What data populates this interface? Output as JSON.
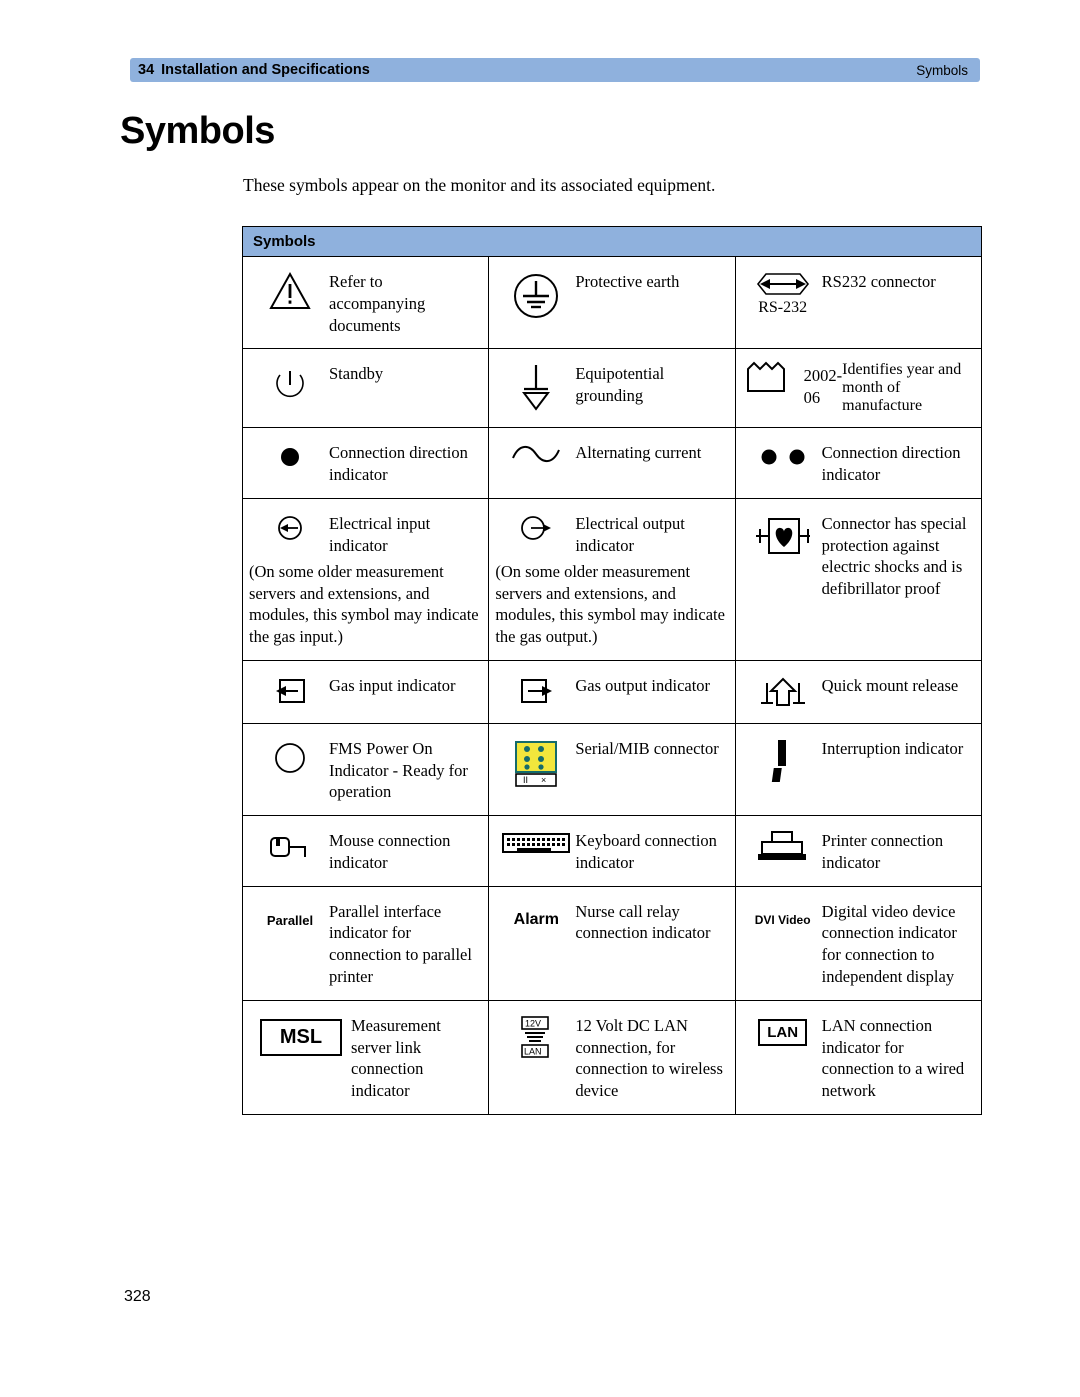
{
  "header": {
    "chapter_number": "34",
    "chapter_title": "Installation and Specifications",
    "section": "Symbols"
  },
  "page_title": "Symbols",
  "intro": "These symbols appear on the monitor and its associated equipment.",
  "table": {
    "caption": "Symbols",
    "rows": [
      {
        "cells": [
          {
            "icon": "warning-triangle-icon",
            "text": "Refer to accompanying documents"
          },
          {
            "icon": "protective-earth-icon",
            "text": "Protective earth"
          },
          {
            "icon": "rs232-connector-icon",
            "icon_label": "RS-232",
            "text": "RS232 connector"
          }
        ]
      },
      {
        "cells": [
          {
            "icon": "standby-icon",
            "text": "Standby"
          },
          {
            "icon": "equipotential-grounding-icon",
            "text": "Equipotential grounding"
          },
          {
            "icon": "manufacture-date-icon",
            "icon_label": "2002-06",
            "text": "Identifies year and month of manufacture"
          }
        ]
      },
      {
        "cells": [
          {
            "icon": "filled-dot-icon",
            "text": "Connection direction indicator"
          },
          {
            "icon": "alternating-current-icon",
            "text": "Alternating current"
          },
          {
            "icon": "double-dot-icon",
            "text": "Connection direction indicator"
          }
        ]
      },
      {
        "cells": [
          {
            "icon": "electrical-input-icon",
            "text": "Electrical input indicator",
            "note": "(On some older measurement servers and extensions, and modules, this symbol may indicate the gas input.)"
          },
          {
            "icon": "electrical-output-icon",
            "text": "Electrical output indicator",
            "note": "(On some older measurement servers and extensions, and modules, this symbol may indicate the gas output.)"
          },
          {
            "icon": "defibrillator-proof-heart-icon",
            "text": "Connector has special protection against electric shocks and is defibrillator proof"
          }
        ]
      },
      {
        "cells": [
          {
            "icon": "gas-input-icon",
            "text": "Gas input indicator"
          },
          {
            "icon": "gas-output-icon",
            "text": "Gas output indicator"
          },
          {
            "icon": "quick-mount-release-icon",
            "text": "Quick mount release"
          }
        ]
      },
      {
        "cells": [
          {
            "icon": "fms-power-on-circle-icon",
            "text": "FMS Power On Indicator - Ready for operation"
          },
          {
            "icon": "serial-mib-connector-icon",
            "text": "Serial/MIB connector"
          },
          {
            "icon": "interruption-indicator-icon",
            "text": "Interruption indicator"
          }
        ]
      },
      {
        "cells": [
          {
            "icon": "mouse-connection-icon",
            "text": "Mouse connection indicator"
          },
          {
            "icon": "keyboard-icon",
            "text": "Keyboard connection indicator"
          },
          {
            "icon": "printer-icon",
            "text": "Printer connection indicator"
          }
        ]
      },
      {
        "cells": [
          {
            "icon": "parallel-interface-icon",
            "icon_label": "Parallel",
            "text": "Parallel interface indicator for connection to parallel printer"
          },
          {
            "icon": "alarm-icon",
            "icon_label": "Alarm",
            "text": "Nurse call relay connection indicator"
          },
          {
            "icon": "dvi-video-icon",
            "icon_label": "DVI Video",
            "text": "Digital video device connection indicator for connection to independent display"
          }
        ]
      },
      {
        "cells": [
          {
            "icon": "msl-icon",
            "icon_label": "MSL",
            "text": "Measurement server link connection indicator"
          },
          {
            "icon": "dc-lan-12v-icon",
            "icon_label": "12V LAN",
            "text": "12 Volt DC LAN connection, for connection to wireless device"
          },
          {
            "icon": "lan-icon",
            "icon_label": "LAN",
            "text": "LAN connection indicator for connection to a wired network"
          }
        ]
      }
    ]
  },
  "footer": {
    "page_number": "328"
  },
  "colors": {
    "accent": "#8fb1dd",
    "serial_mib_yellow": "#f2e63c",
    "serial_mib_border": "#1a6b6b"
  }
}
